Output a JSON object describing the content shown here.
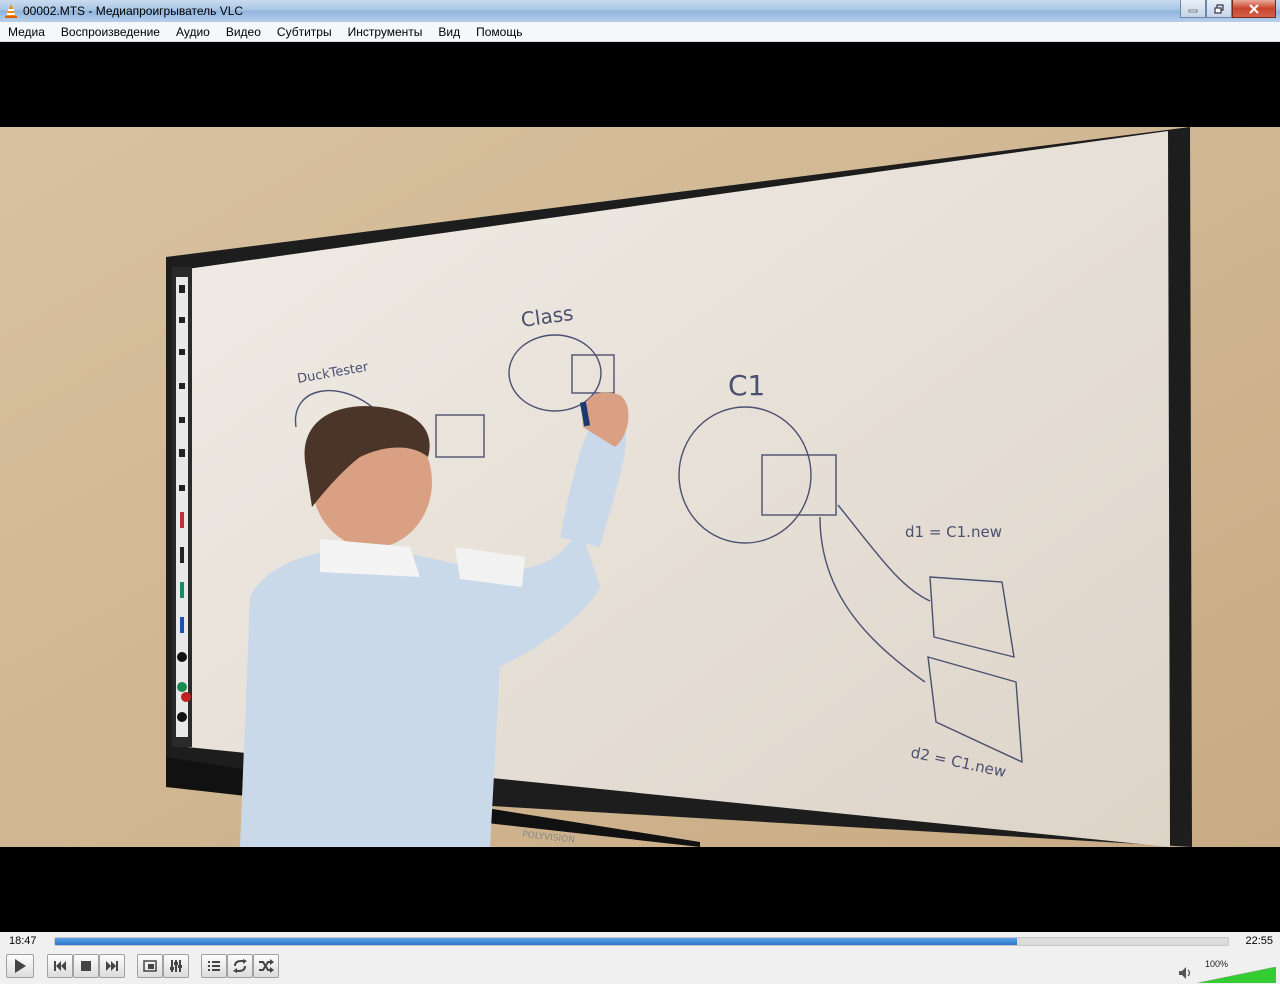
{
  "window": {
    "title": "00002.MTS - Медиапроигрыватель VLC"
  },
  "menu": {
    "items": [
      "Медиа",
      "Воспроизведение",
      "Аудио",
      "Видео",
      "Субтитры",
      "Инструменты",
      "Вид",
      "Помощь"
    ]
  },
  "video": {
    "whiteboard": {
      "label_class": "Class",
      "label_duck": "DuckTester",
      "label_c1": "C1",
      "label_d1": "d1 = C1.new",
      "label_d2": "d2 = C1.new",
      "brand": "POLYVISION"
    }
  },
  "playback": {
    "elapsed": "18:47",
    "total": "22:55",
    "progress_fraction": 0.82
  },
  "volume": {
    "label": "100%",
    "level_fraction": 1.0
  },
  "icons": {
    "app": "vlc-cone-icon",
    "play": "play-icon",
    "prev": "previous-icon",
    "stop": "stop-icon",
    "next": "next-icon",
    "fullscreen": "fullscreen-icon",
    "extended": "extended-settings-icon",
    "playlist": "playlist-icon",
    "loop": "loop-icon",
    "shuffle": "shuffle-icon",
    "speaker": "speaker-icon"
  },
  "colors": {
    "accent": "#2a76c9",
    "volume_green": "#33cc33"
  }
}
